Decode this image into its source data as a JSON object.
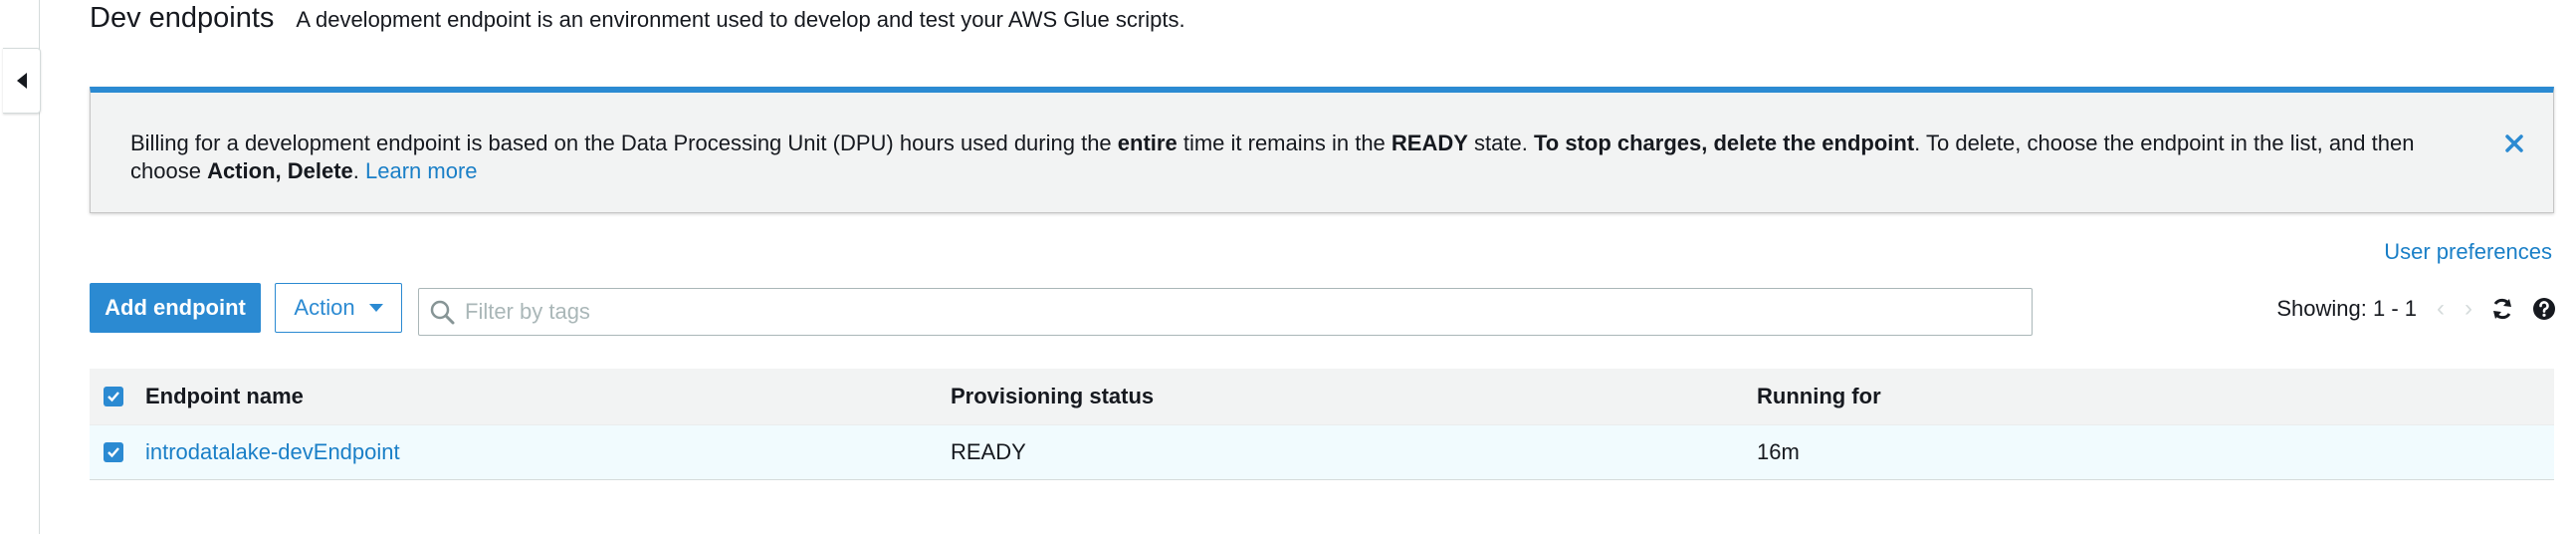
{
  "header": {
    "title": "Dev endpoints",
    "description": "A development endpoint is an environment used to develop and test your AWS Glue scripts."
  },
  "banner": {
    "t1": "Billing for a development endpoint is based on the Data Processing Unit (DPU) hours used during the ",
    "b1": "entire",
    "t2": " time it remains in the ",
    "b2": "READY",
    "t3": " state. ",
    "b3": "To stop charges, delete the endpoint",
    "t4": ". To delete, choose the endpoint in the list, and then choose ",
    "b4": "Action, Delete",
    "t5": ". ",
    "link": "Learn more"
  },
  "toolbar": {
    "add_label": "Add endpoint",
    "action_label": "Action",
    "search_placeholder": "Filter by tags",
    "user_prefs": "User preferences",
    "showing": "Showing: 1 - 1"
  },
  "table": {
    "headers": [
      "Endpoint name",
      "Provisioning status",
      "Running for"
    ],
    "rows": [
      {
        "name": "introdatalake-devEndpoint",
        "status": "READY",
        "running_for": "16m"
      }
    ]
  },
  "colors": {
    "accent": "#2b8ad2",
    "link": "#1a7fc7"
  },
  "icons": {
    "collapse": "caret-left-icon",
    "close": "close-icon",
    "search": "search-icon",
    "refresh": "refresh-icon",
    "help": "help-icon"
  }
}
